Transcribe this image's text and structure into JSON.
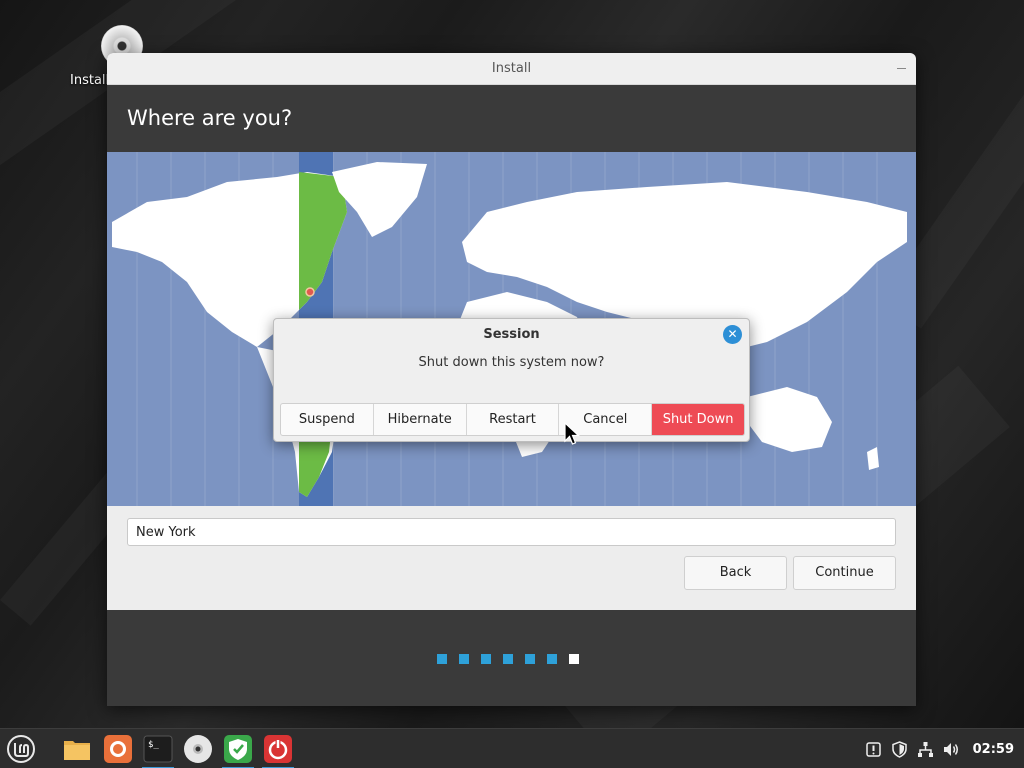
{
  "desktop": {
    "icon_label": "Install"
  },
  "window": {
    "title": "Install",
    "heading": "Where are you?",
    "location_value": "New York",
    "back_label": "Back",
    "continue_label": "Continue",
    "progress": {
      "total_steps": 7,
      "current_step": 7
    }
  },
  "dialog": {
    "title": "Session",
    "message": "Shut down this system now?",
    "buttons": [
      "Suspend",
      "Hibernate",
      "Restart",
      "Cancel",
      "Shut Down"
    ]
  },
  "taskbar": {
    "items": [
      "mint-menu-icon",
      "files-icon",
      "firefox-icon",
      "terminal-icon",
      "installer-disc-icon",
      "shield-icon",
      "power-icon"
    ],
    "clock": "02:59"
  },
  "colors": {
    "accent": "#2ea1d9",
    "danger": "#ee4b55",
    "map_ocean": "#7c94c2",
    "map_land": "#ffffff",
    "timezone_highlight": "#6cbb45"
  }
}
